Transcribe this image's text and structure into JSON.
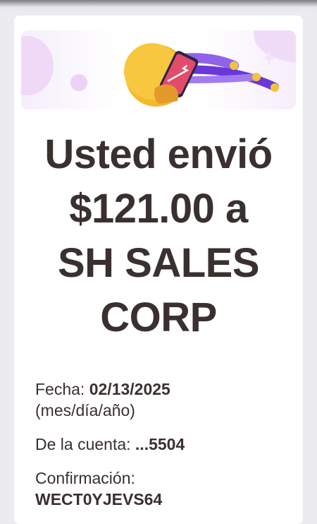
{
  "receipt": {
    "title_lines": [
      "Usted envió",
      "$121.00 a",
      "SH SALES",
      "CORP"
    ],
    "date_label": "Fecha:",
    "date_value": "02/13/2025",
    "date_format": "(mes/día/año)",
    "account_label": "De la cuenta:",
    "account_value": "...5504",
    "confirmation_label": "Confirmación:",
    "confirmation_value": "WECT0YJEVS64"
  },
  "colors": {
    "text": "#3a302f",
    "accent_purple": "#7b3fe0",
    "accent_yellow": "#f5b92e",
    "hero_bg": "#f3e9fb"
  },
  "icons": [
    "phone-send-icon",
    "sparkle-icon"
  ]
}
